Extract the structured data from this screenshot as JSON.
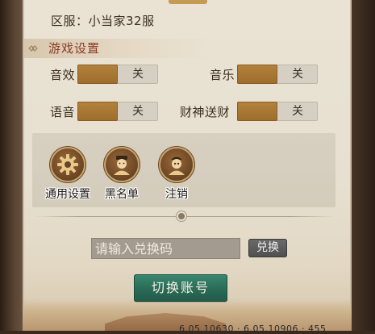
{
  "server": {
    "label": "区服：小当家32服"
  },
  "game_settings": {
    "title": "游戏设置",
    "items": [
      {
        "label": "音效",
        "state": "关"
      },
      {
        "label": "音乐",
        "state": "关"
      },
      {
        "label": "语音",
        "state": "关"
      },
      {
        "label": "财神送财",
        "state": "关"
      }
    ]
  },
  "functions": [
    {
      "label": "通用设置",
      "icon": "gear-icon"
    },
    {
      "label": "黑名单",
      "icon": "blacklist-avatar-icon"
    },
    {
      "label": "注销",
      "icon": "logout-avatar-icon"
    }
  ],
  "redeem": {
    "placeholder": "请输入兑换码",
    "button_label": "兑换"
  },
  "account": {
    "switch_label": "切换账号"
  },
  "version_text": "6.05.10630 · 6.05.10906 · 455",
  "colors": {
    "toggle_thumb": "#a8772f",
    "section_title": "#8c3a24",
    "switch_button": "#2a6b56",
    "redeem_button": "#555555"
  }
}
